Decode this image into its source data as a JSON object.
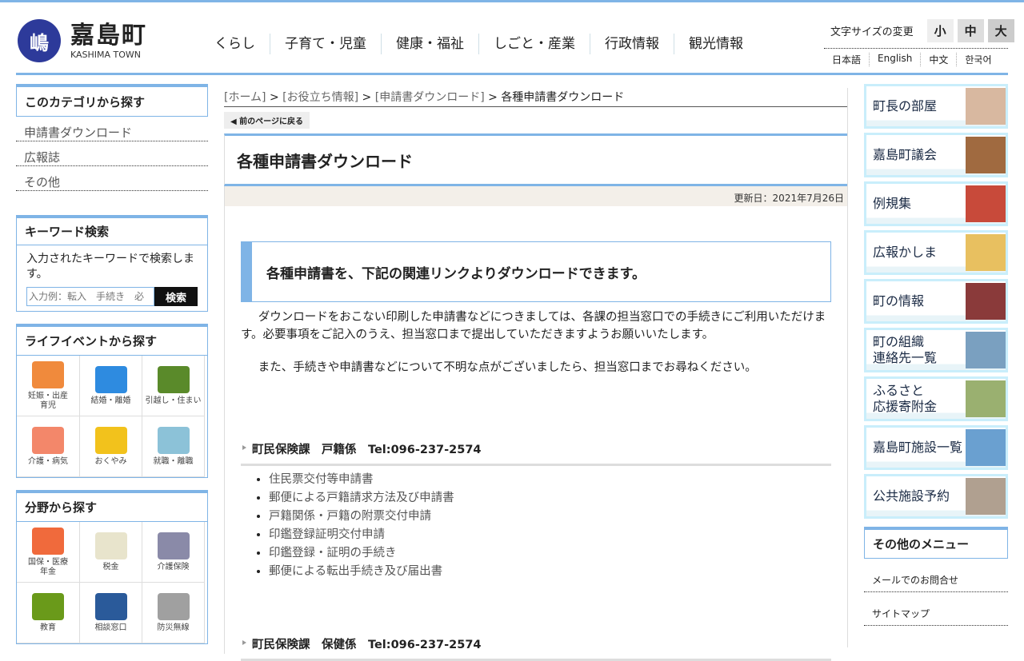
{
  "header": {
    "logo_mark": "嶋",
    "logo_jp": "嘉島町",
    "logo_en": "KASHIMA TOWN",
    "nav": [
      "くらし",
      "子育て・児童",
      "健康・福祉",
      "しごと・産業",
      "行政情報",
      "観光情報"
    ],
    "font_size_label": "文字サイズの変更",
    "font_sizes": [
      "小",
      "中",
      "大"
    ],
    "languages": [
      "日本語",
      "English",
      "中文",
      "한국어"
    ]
  },
  "left": {
    "category_title": "このカテゴリから探す",
    "category_links": [
      "申請書ダウンロード",
      "広報誌",
      "その他"
    ],
    "keyword_title": "キーワード検索",
    "keyword_desc": "入力されたキーワードで検索します。",
    "keyword_placeholder": "入力例：転入　手続き　必",
    "search_button": "検索",
    "life_title": "ライフイベントから探す",
    "life": [
      {
        "label": "妊娠・出産\n育児",
        "color": "#f08a3c"
      },
      {
        "label": "結婚・離婚",
        "color": "#2e8be0"
      },
      {
        "label": "引越し・住まい",
        "color": "#5a8a2a"
      },
      {
        "label": "介護・病気",
        "color": "#f3876a"
      },
      {
        "label": "おくやみ",
        "color": "#f2c21c"
      },
      {
        "label": "就職・離職",
        "color": "#8cc2d8"
      }
    ],
    "field_title": "分野から探す",
    "field": [
      {
        "label": "国保・医療\n年金",
        "color": "#f06a3c"
      },
      {
        "label": "税金",
        "color": "#e8e4cc"
      },
      {
        "label": "介護保険",
        "color": "#8a8aa8"
      },
      {
        "label": "教育",
        "color": "#6a9a1a"
      },
      {
        "label": "相談窓口",
        "color": "#2a5a9a"
      },
      {
        "label": "防災無線",
        "color": "#a0a0a0"
      }
    ]
  },
  "main": {
    "breadcrumb": [
      "[ホーム]",
      "[お役立ち情報]",
      "[申請書ダウンロード]",
      "各種申請書ダウンロード"
    ],
    "back": "前のページに戻る",
    "title": "各種申請書ダウンロード",
    "updated": "更新日：2021年7月26日",
    "callout": "各種申請書を、下記の関連リンクよりダウンロードできます。",
    "para1": "ダウンロードをおこない印刷した申請書などにつきましては、各課の担当窓口での手続きにご利用いただけます。必要事項をご記入のうえ、担当窓口まで提出していただきますようお願いいたします。",
    "para2": "また、手続きや申請書などについて不明な点がございましたら、担当窓口までお尋ねください。",
    "section1": "町民保険課　戸籍係　Tel:096-237-2574",
    "docs": [
      "住民票交付等申請書",
      "郵便による戸籍請求方法及び申請書",
      "戸籍関係・戸籍の附票交付申請",
      "印鑑登録証明交付申請",
      "印鑑登録・証明の手続き",
      "郵便による転出手続き及び届出書"
    ],
    "section2": "町民保険課　保健係　Tel:096-237-2574"
  },
  "right": {
    "banners": [
      "町長の部屋",
      "嘉島町議会",
      "例規集",
      "広報かしま",
      "町の情報",
      "町の組織\n連絡先一覧",
      "ふるさと\n応援寄附金",
      "嘉島町施設一覧",
      "公共施設予約"
    ],
    "other_title": "その他のメニュー",
    "other": [
      "メールでのお問合せ",
      "サイトマップ"
    ]
  }
}
